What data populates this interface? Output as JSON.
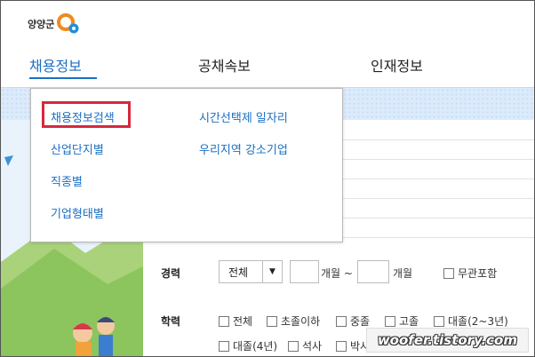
{
  "header": {
    "logo_text": "양양군",
    "nav": [
      {
        "label": "채용정보"
      },
      {
        "label": "공채속보"
      },
      {
        "label": "인재정보"
      }
    ]
  },
  "dropdown": {
    "col1": [
      "채용정보검색",
      "산업단지별",
      "직종별",
      "기업형태별"
    ],
    "col2": [
      "시간선택제 일자리",
      "우리지역 강소기업"
    ]
  },
  "form": {
    "career_label": "경력",
    "career_select": "전체",
    "career_arrow": "▼",
    "unit1": "개월 ~",
    "unit2": "개월",
    "career_any": "무관포함",
    "edu_label": "학력",
    "edu_options": [
      "전체",
      "초졸이하",
      "중졸",
      "고졸",
      "대졸(2~3년)",
      "대졸(4년)",
      "석사",
      "박사"
    ]
  },
  "watermark": "woofer.tistory.com",
  "colors": {
    "accent": "#1a6fc4",
    "highlight": "#d6283e",
    "pattern": "#dcebfb"
  }
}
